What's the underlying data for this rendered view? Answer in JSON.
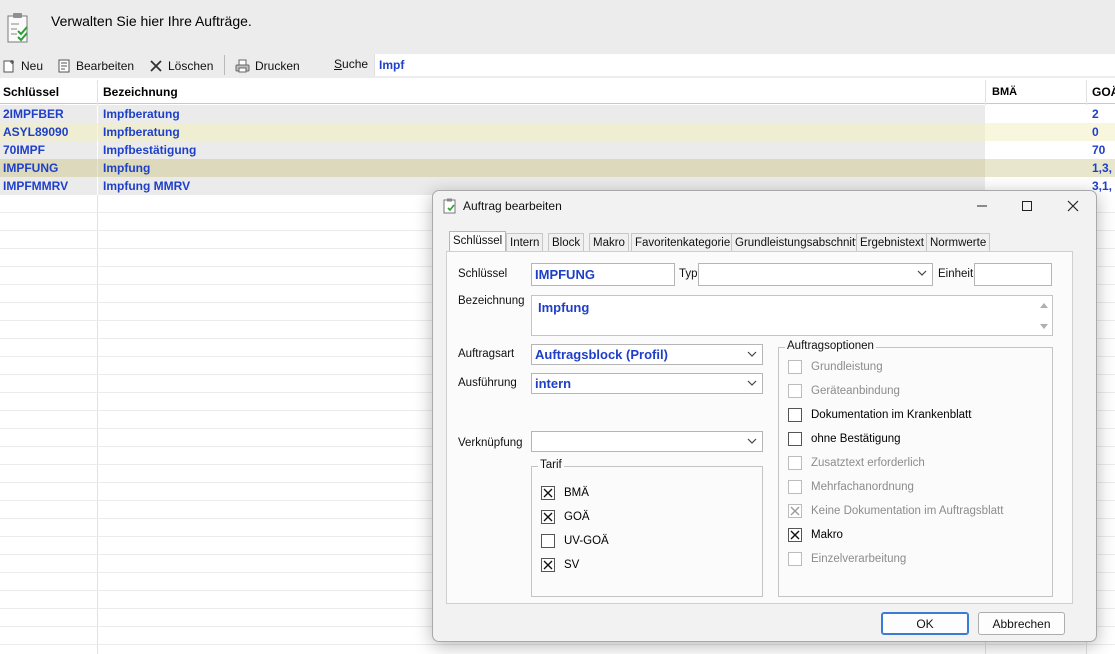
{
  "header": {
    "title": "Verwalten Sie hier Ihre Aufträge."
  },
  "toolbar": {
    "new_label": "Neu",
    "edit_label": "Bearbeiten",
    "delete_label": "Löschen",
    "print_label": "Drucken",
    "search_label_first": "S",
    "search_label_rest": "uche",
    "search_value": "Impf"
  },
  "grid": {
    "columns": [
      "Schlüssel",
      "Bezeichnung",
      "BMÄ",
      "GOÄ"
    ],
    "rows": [
      {
        "key": "2IMPFBER",
        "name": "Impfberatung",
        "bma": "",
        "goa": "2"
      },
      {
        "key": "ASYL89090",
        "name": "Impfberatung",
        "bma": "",
        "goa": "0"
      },
      {
        "key": "70IMPF",
        "name": "Impfbestätigung",
        "bma": "",
        "goa": "70"
      },
      {
        "key": "IMPFUNG",
        "name": "Impfung",
        "bma": "",
        "goa": "1,3,"
      },
      {
        "key": "IMPFMMRV",
        "name": "Impfung MMRV",
        "bma": "",
        "goa": "3,1,"
      }
    ]
  },
  "dialog": {
    "title": "Auftrag bearbeiten",
    "tabs": [
      "Schlüssel",
      "Intern",
      "Block",
      "Makro",
      "Favoritenkategorie",
      "Grundleistungsabschnitt",
      "Ergebnistext",
      "Normwerte"
    ],
    "fields": {
      "schluessel_label": "Schlüssel",
      "schluessel_value": "IMPFUNG",
      "typ_label": "Typ",
      "typ_value": "",
      "einheit_label": "Einheit",
      "einheit_value": "",
      "bezeichnung_label": "Bezeichnung",
      "bezeichnung_value": "Impfung",
      "auftragsart_label": "Auftragsart",
      "auftragsart_value": "Auftragsblock (Profil)",
      "ausfuehrung_label": "Ausführung",
      "ausfuehrung_value": "intern",
      "verknuepfung_label": "Verknüpfung",
      "verknuepfung_value": ""
    },
    "tarif": {
      "title": "Tarif",
      "items": [
        {
          "label": "BMÄ",
          "checked": true
        },
        {
          "label": "GOÄ",
          "checked": true
        },
        {
          "label": "UV-GOÄ",
          "checked": false
        },
        {
          "label": "SV",
          "checked": true
        }
      ]
    },
    "options": {
      "title": "Auftragsoptionen",
      "items": [
        {
          "label": "Grundleistung",
          "checked": false,
          "enabled": false
        },
        {
          "label": "Geräteanbindung",
          "checked": false,
          "enabled": false
        },
        {
          "label": "Dokumentation im Krankenblatt",
          "checked": false,
          "enabled": true
        },
        {
          "label": "ohne Bestätigung",
          "checked": false,
          "enabled": true
        },
        {
          "label": "Zusatztext erforderlich",
          "checked": false,
          "enabled": false
        },
        {
          "label": "Mehrfachanordnung",
          "checked": false,
          "enabled": false
        },
        {
          "label": "Keine Dokumentation im Auftragsblatt",
          "checked": true,
          "enabled": false
        },
        {
          "label": "Makro",
          "checked": true,
          "enabled": true
        },
        {
          "label": "Einzelverarbeitung",
          "checked": false,
          "enabled": false
        }
      ]
    },
    "ok_label": "OK",
    "cancel_label": "Abbrechen"
  }
}
